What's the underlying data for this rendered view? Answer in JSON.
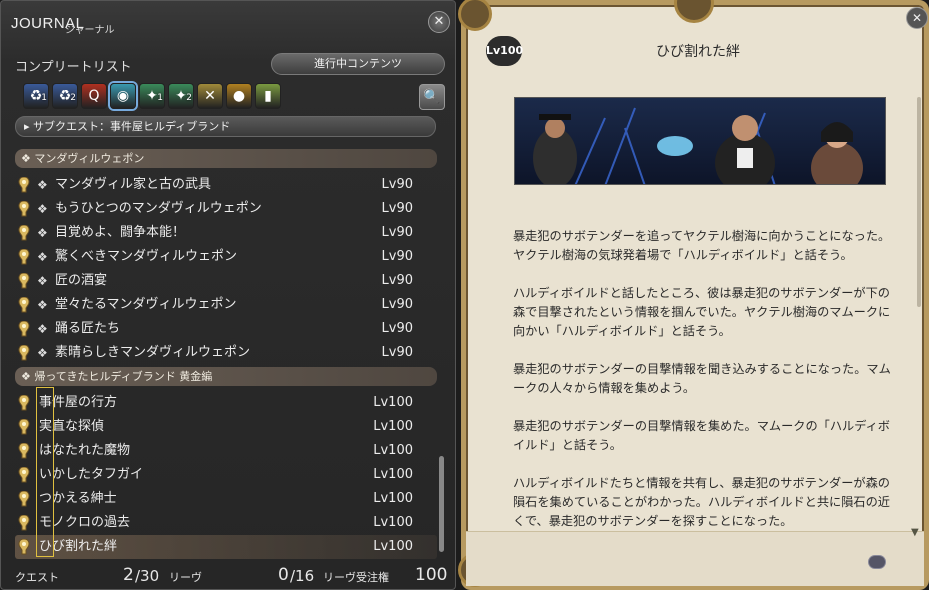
{
  "journal": {
    "title": "JOURNAL",
    "subtitle": "ジャーナル",
    "close_icon": "close-icon",
    "list_label": "コンプリートリスト",
    "in_progress_button": "進行中コンテンツ",
    "filters": [
      {
        "icon": "msq-1-icon",
        "color": "#3a5a9a",
        "glyph": "♻",
        "sub": "1"
      },
      {
        "icon": "msq-2-icon",
        "color": "#3a5a9a",
        "glyph": "♻",
        "sub": "2"
      },
      {
        "icon": "feature-quest-icon",
        "color": "#b03020",
        "glyph": "Q",
        "sub": ""
      },
      {
        "icon": "sidequest-icon",
        "color": "#3a9ab0",
        "glyph": "◉",
        "sub": "",
        "active": true
      },
      {
        "icon": "leve-1-icon",
        "color": "#3a8a5a",
        "glyph": "✦",
        "sub": "1"
      },
      {
        "icon": "leve-2-icon",
        "color": "#3a8a5a",
        "glyph": "✦",
        "sub": "2"
      },
      {
        "icon": "crossed-swords-icon",
        "color": "#a08a3a",
        "glyph": "✕",
        "sub": ""
      },
      {
        "icon": "bag-icon",
        "color": "#b08020",
        "glyph": "●",
        "sub": ""
      },
      {
        "icon": "card-icon",
        "color": "#7a9a40",
        "glyph": "▮",
        "sub": ""
      }
    ],
    "category": "▸ サブクエスト：事件屋ヒルディブランド",
    "groups": [
      {
        "label": "❖ マンダヴィルウェポン",
        "quests": [
          {
            "name": "マンダヴィル家と古の武具",
            "level": "Lv90",
            "mark": "❖"
          },
          {
            "name": "もうひとつのマンダヴィルウェポン",
            "level": "Lv90",
            "mark": "❖"
          },
          {
            "name": "目覚めよ、闘争本能！",
            "level": "Lv90",
            "mark": "❖"
          },
          {
            "name": "驚くべきマンダヴィルウェポン",
            "level": "Lv90",
            "mark": "❖"
          },
          {
            "name": "匠の酒宴",
            "level": "Lv90",
            "mark": "❖"
          },
          {
            "name": "堂々たるマンダヴィルウェポン",
            "level": "Lv90",
            "mark": "❖"
          },
          {
            "name": "踊る匠たち",
            "level": "Lv90",
            "mark": "❖"
          },
          {
            "name": "素晴らしきマンダヴィルウェポン",
            "level": "Lv90",
            "mark": "❖"
          }
        ]
      },
      {
        "label": "❖ 帰ってきたヒルディブランド 黄金編",
        "quests": [
          {
            "name": "事件屋の行方",
            "level": "Lv100",
            "mark": ""
          },
          {
            "name": "実直な探偵",
            "level": "Lv100",
            "mark": ""
          },
          {
            "name": "はなたれた魔物",
            "level": "Lv100",
            "mark": ""
          },
          {
            "name": "いかしたタフガイ",
            "level": "Lv100",
            "mark": ""
          },
          {
            "name": "つかえる紳士",
            "level": "Lv100",
            "mark": ""
          },
          {
            "name": "モノクロの過去",
            "level": "Lv100",
            "mark": ""
          },
          {
            "name": "ひび割れた絆",
            "level": "Lv100",
            "mark": "",
            "selected": true
          }
        ]
      }
    ],
    "footer": {
      "quest_label": "クエスト",
      "quest_count": "2",
      "quest_total": "/30",
      "leve_label": "リーヴ",
      "leve_count": "0",
      "leve_total": "/16",
      "leve_allow_label": "リーヴ受注権",
      "leve_allow_value": "100"
    }
  },
  "detail": {
    "level_badge": "Lv100",
    "title": "ひび割れた絆",
    "paragraphs": [
      "暴走犯のサボテンダーを追ってヤクテル樹海に向かうことになった。ヤクテル樹海の気球発着場で「ハルディボイルド」と話そう。",
      "ハルディボイルドと話したところ、彼は暴走犯のサボテンダーが下の森で目撃されたという情報を掴んでいた。ヤクテル樹海のマムークに向かい「ハルディボイルド」と話そう。",
      "暴走犯のサボテンダーの目撃情報を聞き込みすることになった。マムークの人々から情報を集めよう。",
      "暴走犯のサボテンダーの目撃情報を集めた。マムークの「ハルディボイルド」と話そう。",
      "ハルディボイルドたちと情報を共有し、暴走犯のサボテンダーが森の隕石を集めていることがわかった。ハルディボイルドと共に隕石の近くで、暴走犯のサボテンダーを探すことになった。"
    ]
  },
  "colors": {
    "accent_gold": "#b79a60",
    "parchment": "#e9e2d1",
    "selection": "#e0c040"
  }
}
